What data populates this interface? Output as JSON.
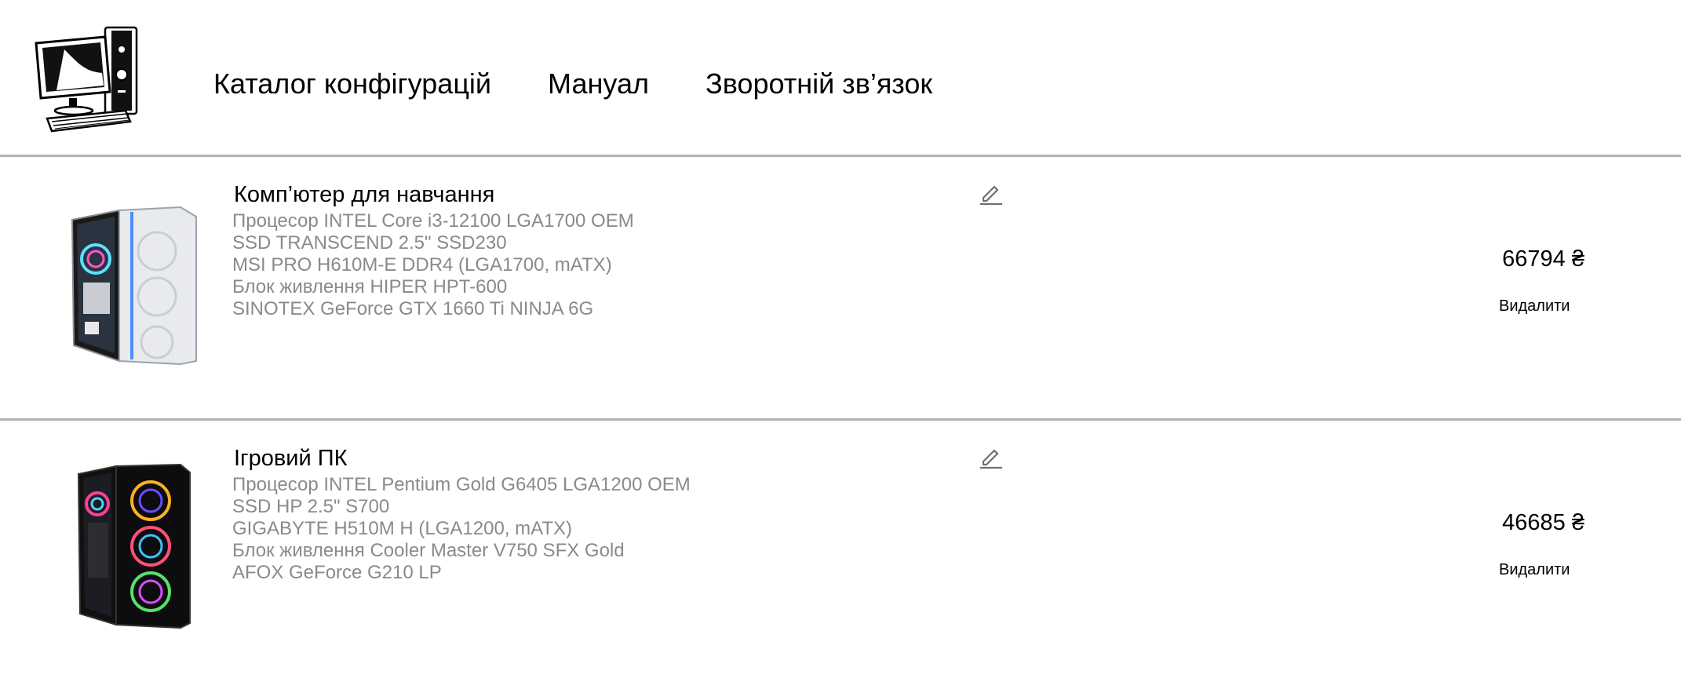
{
  "nav": {
    "logo_icon": "computer-monitor-keyboard-icon",
    "items": [
      {
        "label": "Каталог конфігурацій"
      },
      {
        "label": "Мануал"
      },
      {
        "label": "Зворотній зв’язок"
      }
    ]
  },
  "configs": [
    {
      "name": "Комп’ютер для навчання",
      "image_icon": "white-pc-case-icon",
      "parts": [
        "Процесор INTEL Core i3-12100 LGA1700 OEM",
        "SSD TRANSCEND 2.5\" SSD230",
        "MSI PRO H610M-E DDR4 (LGA1700, mATX)",
        "Блок живлення HIPER HPT-600",
        "SINOTEX GeForce GTX 1660 Ti NINJA 6G"
      ],
      "price": "66794 ₴",
      "delete_label": "Видалити",
      "edit_icon": "pencil-icon"
    },
    {
      "name": "Ігровий ПК",
      "image_icon": "black-rgb-pc-case-icon",
      "parts": [
        "Процесор INTEL Pentium Gold G6405 LGA1200 OEM",
        "SSD HP 2.5\" S700",
        "GIGABYTE H510M H (LGA1200, mATX)",
        "Блок живлення Cooler Master V750 SFX Gold",
        "AFOX GeForce G210 LP"
      ],
      "price": "46685 ₴",
      "delete_label": "Видалити",
      "edit_icon": "pencil-icon"
    }
  ],
  "colors": {
    "divider": "#b3b3b3",
    "muted_text": "#8a8a8a",
    "text": "#000000"
  }
}
